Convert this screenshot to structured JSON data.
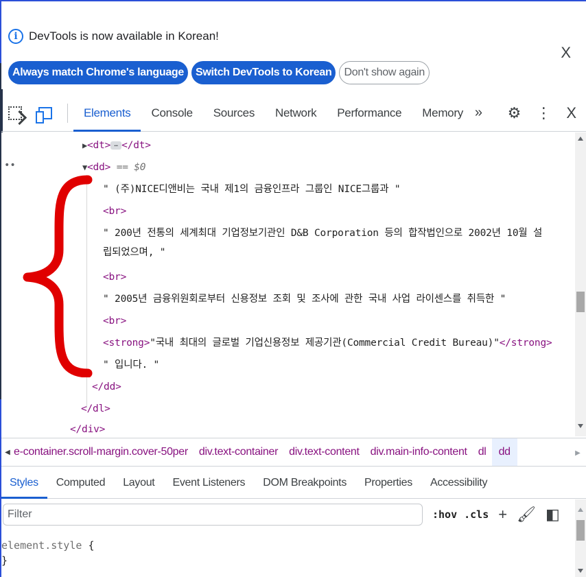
{
  "infobar": {
    "message": "DevTools is now available in Korean!",
    "buttons": [
      "Always match Chrome's language",
      "Switch DevTools to Korean",
      "Don't show again"
    ],
    "close": "X"
  },
  "toolbar": {
    "tabs": [
      "Elements",
      "Console",
      "Sources",
      "Network",
      "Performance",
      "Memory"
    ],
    "active_tab": "Elements",
    "more": "»",
    "settings_icon": "gear-icon",
    "menu_icon": "kebab-icon",
    "close": "X"
  },
  "elements": {
    "lines": [
      {
        "open": "<dt>",
        "ellipsis": "…",
        "close": "</dt>"
      },
      {
        "open": "<dd>",
        "eq": "== $0"
      },
      {
        "text": "\" (주)NICE디앤비는 국내 제1의 금융인프라 그룹인 NICE그룹과 \""
      },
      {
        "tag": "<br>"
      },
      {
        "text": "\" 200년 전통의 세계최대 기업정보기관인 D&B Corporation 등의 합작법인으로 2002년 10월 설"
      },
      {
        "text": "립되었으며, \""
      },
      {
        "tag": "<br>"
      },
      {
        "text": "\" 2005년 금융위원회로부터 신용정보 조회 및 조사에 관한 국내 사업 라이센스를 취득한 \""
      },
      {
        "tag": "<br>"
      },
      {
        "strong_open": "<strong>",
        "strong_text": "\"국내 최대의 글로벌 기업신용정보 제공기관(Commercial Credit Bureau)\"",
        "strong_close": "</strong>"
      },
      {
        "text": "\" 입니다. \""
      },
      {
        "tag": "</dd>"
      },
      {
        "tag": "</dl>"
      },
      {
        "tag": "</div>"
      }
    ],
    "gutter_dots": "••"
  },
  "breadcrumbs": [
    "e-container.scroll-margin.cover-50per",
    "div.text-container",
    "div.text-content",
    "div.main-info-content",
    "dl",
    "dd"
  ],
  "subtabs": [
    "Styles",
    "Computed",
    "Layout",
    "Event Listeners",
    "DOM Breakpoints",
    "Properties",
    "Accessibility"
  ],
  "filter": {
    "placeholder": "Filter",
    "hov": ":hov",
    "cls": ".cls",
    "add": "+"
  },
  "styles": {
    "selector": "element.style",
    "open_brace": "{",
    "close_brace": "}"
  },
  "colors": {
    "accent": "#1a5fd0",
    "tag": "#881280",
    "annotation": "#e00000"
  }
}
